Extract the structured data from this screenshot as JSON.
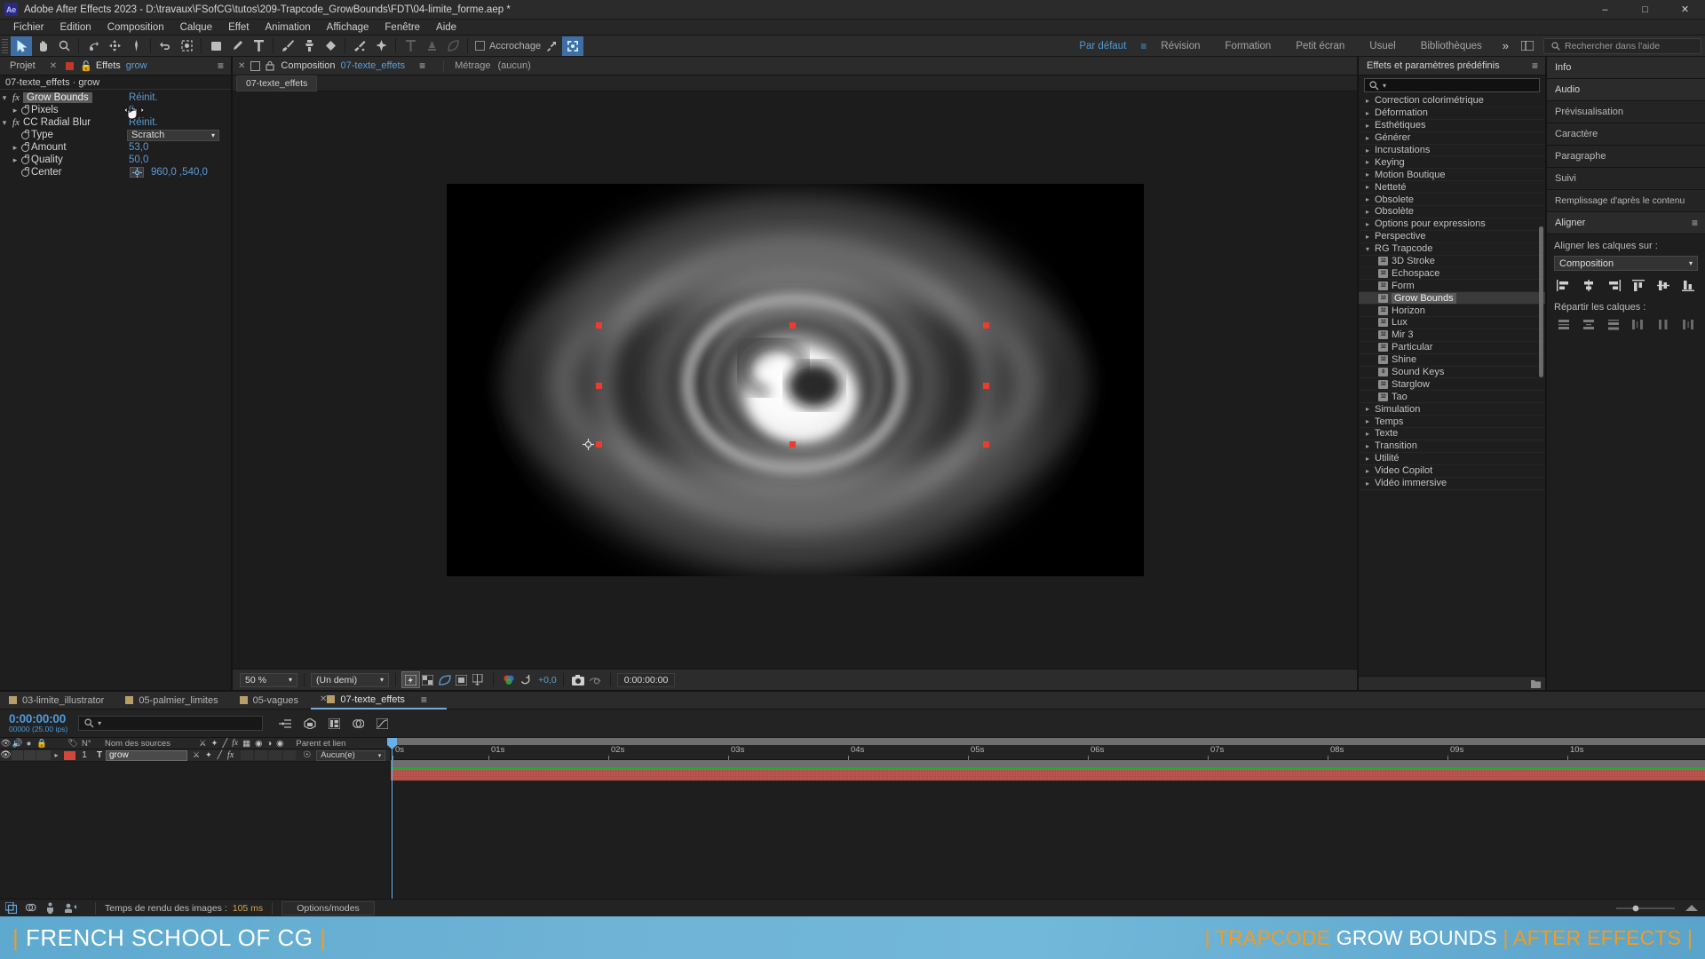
{
  "window": {
    "app_badge": "Ae",
    "title": "Adobe After Effects 2023 - D:\\travaux\\FSofCG\\tutos\\209-Trapcode_GrowBounds\\FDT\\04-limite_forme.aep *",
    "minimize": "–",
    "maximize": "□",
    "close": "✕"
  },
  "menubar": {
    "items": [
      "Fichier",
      "Edition",
      "Composition",
      "Calque",
      "Effet",
      "Animation",
      "Affichage",
      "Fenêtre",
      "Aide"
    ]
  },
  "toolbar": {
    "snapping_label": "Accrochage",
    "workspaces": [
      "Par défaut",
      "Révision",
      "Formation",
      "Petit écran",
      "Usuel",
      "Bibliothèques"
    ],
    "active_workspace": "Par défaut",
    "more_chevron": "»",
    "search_placeholder": "Rechercher dans l'aide"
  },
  "effect_controls": {
    "panel_tab": "Projet",
    "close_x": "✕",
    "effects_tab": "Effets",
    "layer_name": "grow",
    "burger": "≡",
    "subtitle": "07-texte_effets · grow",
    "rows": [
      {
        "name": "Grow Bounds",
        "value": "Réinit.",
        "kind": "effect",
        "selected": true
      },
      {
        "name": "Pixels",
        "value": "0",
        "kind": "prop",
        "twirl": true
      },
      {
        "name": "CC Radial Blur",
        "value": "Réinit.",
        "kind": "effect"
      },
      {
        "name": "Type",
        "value": "Scratch",
        "kind": "dropdown"
      },
      {
        "name": "Amount",
        "value": "53,0",
        "kind": "prop",
        "twirl": true
      },
      {
        "name": "Quality",
        "value": "50,0",
        "kind": "prop",
        "twirl": true
      },
      {
        "name": "Center",
        "value": "960,0 ,540,0",
        "kind": "point"
      }
    ]
  },
  "composition": {
    "close_x": "✕",
    "tab_label": "Composition",
    "comp_name": "07-texte_effets",
    "burger": "≡",
    "footage_label": "Métrage",
    "footage_value": "(aucun)",
    "sub_tab": "07-texte_effets",
    "bottom_bar": {
      "zoom": "50 %",
      "resolution": "(Un demi)",
      "exposure": "+0,0",
      "timecode": "0:00:00:00"
    }
  },
  "effects_presets": {
    "title": "Effets et paramètres prédéfinis",
    "burger": "≡",
    "search_placeholder": "",
    "categories": [
      {
        "label": "Correction colorimétrique",
        "expanded": false
      },
      {
        "label": "Déformation",
        "expanded": false
      },
      {
        "label": "Esthétiques",
        "expanded": false
      },
      {
        "label": "Générer",
        "expanded": false
      },
      {
        "label": "Incrustations",
        "expanded": false
      },
      {
        "label": "Keying",
        "expanded": false
      },
      {
        "label": "Motion Boutique",
        "expanded": false
      },
      {
        "label": "Netteté",
        "expanded": false
      },
      {
        "label": "Obsolete",
        "expanded": false
      },
      {
        "label": "Obsolète",
        "expanded": false
      },
      {
        "label": "Options pour expressions",
        "expanded": false
      },
      {
        "label": "Perspective",
        "expanded": false
      },
      {
        "label": "RG Trapcode",
        "expanded": true
      }
    ],
    "trapcode_effects": [
      {
        "label": "3D Stroke",
        "badge": "32"
      },
      {
        "label": "Echospace",
        "badge": "32"
      },
      {
        "label": "Form",
        "badge": "32"
      },
      {
        "label": "Grow Bounds",
        "badge": "32",
        "selected": true
      },
      {
        "label": "Horizon",
        "badge": "32"
      },
      {
        "label": "Lux",
        "badge": "32"
      },
      {
        "label": "Mir 3",
        "badge": "32"
      },
      {
        "label": "Particular",
        "badge": "32"
      },
      {
        "label": "Shine",
        "badge": "32"
      },
      {
        "label": "Sound Keys",
        "badge": "8"
      },
      {
        "label": "Starglow",
        "badge": "32"
      },
      {
        "label": "Tao",
        "badge": "32"
      }
    ],
    "categories_after": [
      {
        "label": "Simulation"
      },
      {
        "label": "Temps"
      },
      {
        "label": "Texte"
      },
      {
        "label": "Transition"
      },
      {
        "label": "Utilité"
      },
      {
        "label": "Video Copilot"
      },
      {
        "label": "Vidéo immersive"
      }
    ]
  },
  "side_panels": {
    "tabs": [
      "Info",
      "Audio",
      "Prévisualisation",
      "Caractère",
      "Paragraphe",
      "Suivi",
      "Remplissage d'après le contenu"
    ],
    "align": {
      "title": "Aligner",
      "burger": "≡",
      "align_label": "Aligner les calques sur :",
      "align_target": "Composition",
      "distribute_label": "Répartir les calques :"
    }
  },
  "timeline": {
    "tabs": [
      {
        "label": "03-limite_illustrator",
        "active": false
      },
      {
        "label": "05-palmier_limites",
        "active": false
      },
      {
        "label": "05-vagues",
        "active": false
      },
      {
        "label": "07-texte_effets",
        "active": true
      }
    ],
    "close_x": "✕",
    "current_time": "0:00:00:00",
    "frame_info": "00000 (25.00 ips)",
    "search_placeholder": "",
    "columns": [
      "N°",
      "Nom des sources",
      "Parent et lien"
    ],
    "layer": {
      "index": "1",
      "type_icon": "T",
      "name": "grow",
      "parent": "Aucun(e)"
    },
    "ruler_ticks": [
      "0s",
      "01s",
      "02s",
      "03s",
      "04s",
      "05s",
      "06s",
      "07s",
      "08s",
      "09s",
      "10s"
    ],
    "status": {
      "render_time_label": "Temps de rendu des images :",
      "render_time_value": "105 ms",
      "options_label": "Options/modes"
    }
  },
  "banner": {
    "left": "FRENCH SCHOOL OF CG",
    "right_parts": [
      {
        "text": "|",
        "color": "orange"
      },
      {
        "text": "TRAPCODE",
        "color": "orange"
      },
      {
        "text": "GROW BOUNDS",
        "color": "white"
      },
      {
        "text": "|",
        "color": "orange"
      },
      {
        "text": "AFTER EFFECTS",
        "color": "orange"
      },
      {
        "text": "|",
        "color": "orange"
      }
    ]
  },
  "colors": {
    "accent_blue": "#4e9bd8",
    "value_blue": "#5b9bd5",
    "handle_red": "#ee3b30",
    "layer_red": "#bc564e",
    "green_bar": "#22aa3c",
    "banner_blue": "#6fb3d6",
    "banner_orange": "#f59b1c"
  }
}
